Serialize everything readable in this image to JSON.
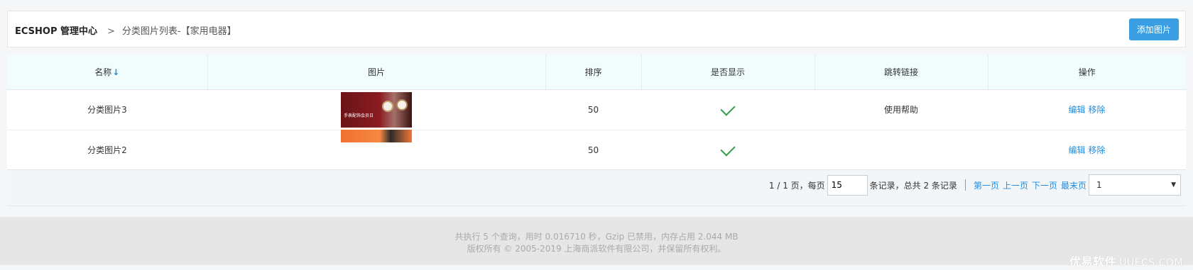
{
  "header": {
    "root": "ECSHOP 管理中心",
    "separator": ">",
    "current": "分类图片列表-【家用电器】",
    "add_button": "添加图片"
  },
  "table": {
    "columns": [
      "名称",
      "图片",
      "排序",
      "是否显示",
      "跳转链接",
      "操作"
    ],
    "sort_icon": "↓",
    "rows": [
      {
        "name": "分类图片3",
        "image": "watch-banner-image",
        "image_caption": "手表配饰会员日",
        "sort": "50",
        "show": true,
        "link": "使用帮助",
        "edit": "编辑",
        "remove": "移除"
      },
      {
        "name": "分类图片2",
        "image": "orange-banner-image",
        "sort": "50",
        "show": true,
        "link": "",
        "edit": "编辑",
        "remove": "移除"
      }
    ]
  },
  "pager": {
    "page_info": "1 / 1 页，每页",
    "page_size": "15",
    "records_info": "条记录，总共 2 条记录",
    "first": "第一页",
    "prev": "上一页",
    "next": "下一页",
    "last": "最末页",
    "page_select": "1"
  },
  "footer": {
    "line1": "共执行 5 个查询，用时 0.016710 秒，Gzip 已禁用，内存占用 2.044 MB",
    "line2": "版权所有 © 2005-2019 上海商派软件有限公司，并保留所有权利。",
    "watermark_main": "优易软件",
    "watermark_sub": "UUECS.COM"
  },
  "colors": {
    "accent": "#3a9fe2",
    "link": "#1e8de0",
    "check": "#2e9e4a",
    "table_header_bg": "#f1fcfc"
  }
}
